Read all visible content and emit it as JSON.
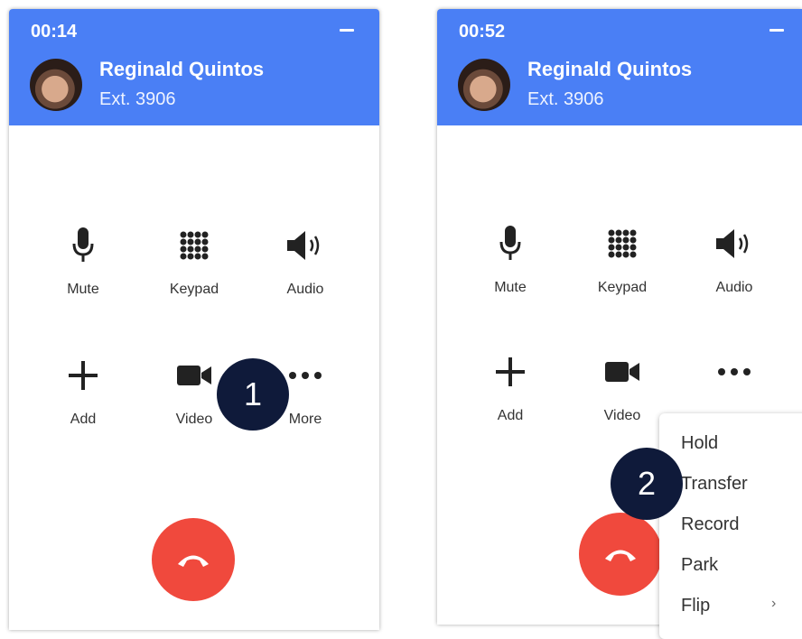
{
  "panel1": {
    "timer": "00:14",
    "caller": {
      "name": "Reginald Quintos",
      "extension": "Ext. 3906"
    },
    "buttons": {
      "mute": "Mute",
      "keypad": "Keypad",
      "audio": "Audio",
      "add": "Add",
      "video": "Video",
      "more": "More"
    },
    "callout": "1"
  },
  "panel2": {
    "timer": "00:52",
    "caller": {
      "name": "Reginald Quintos",
      "extension": "Ext. 3906"
    },
    "buttons": {
      "mute": "Mute",
      "keypad": "Keypad",
      "audio": "Audio",
      "add": "Add",
      "video": "Video"
    },
    "callout": "2",
    "menu": [
      "Hold",
      "Transfer",
      "Record",
      "Park",
      "Flip"
    ],
    "menu_arrow": "›"
  },
  "colors": {
    "header": "#4a7ff5",
    "hangup": "#f0493d",
    "callout": "#0f1a3a"
  },
  "icons": [
    "minimize-icon",
    "microphone-icon",
    "keypad-icon",
    "speaker-icon",
    "plus-icon",
    "video-camera-icon",
    "more-dots-icon",
    "hang-up-icon",
    "chevron-right-icon"
  ]
}
